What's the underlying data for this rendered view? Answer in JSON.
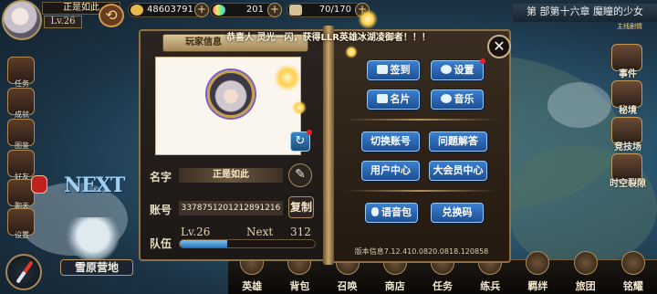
{
  "top": {
    "player_name": "正是如此",
    "level": "Lv.26",
    "resources": [
      {
        "icon": "gold-coin-icon",
        "value": "48603791"
      },
      {
        "icon": "rainbow-crystal-icon",
        "value": "201"
      },
      {
        "icon": "scroll-stamina-icon",
        "value": "70/170"
      }
    ],
    "chapter_title": "第 部第十六章 魔瞳的少女",
    "sub_chapter": "主线剧情"
  },
  "left_menu": [
    {
      "label": "任务",
      "icon": "quest-icon"
    },
    {
      "label": "成就",
      "icon": "achievement-icon"
    },
    {
      "label": "图鉴",
      "icon": "codex-icon"
    },
    {
      "label": "好友",
      "icon": "friend-icon"
    },
    {
      "label": "聊天",
      "icon": "chat-icon"
    },
    {
      "label": "设置",
      "icon": "setting-icon"
    }
  ],
  "next_logo": "NEXT",
  "map_node_label": "雪原营地",
  "right_menu": [
    {
      "label": "事件",
      "icon": "event-icon"
    },
    {
      "label": "秘境",
      "icon": "secret-realm-icon"
    },
    {
      "label": "竞技场",
      "icon": "arena-icon"
    },
    {
      "label": "时空裂隙",
      "icon": "rift-icon"
    }
  ],
  "bottom_nav": [
    "英雄",
    "背包",
    "召唤",
    "商店",
    "任务",
    "练兵",
    "羁绊",
    "旅团",
    "铭耀"
  ],
  "dialog": {
    "announcement": "恭喜人 灵光一闪，获得LLR英雄冰湖凌御者！！！",
    "title": "玩家信息",
    "name_label": "名字",
    "name_value": "正是如此",
    "account_label": "账号",
    "account_value": "3378751201212891216",
    "copy_label": "复制",
    "team_label": "队伍",
    "level_text": "Lv.26",
    "next_label": "Next",
    "next_value": "312",
    "exp_progress": 0.35,
    "buttons": {
      "sign_in": "签到",
      "settings": "设置",
      "card": "名片",
      "music": "音乐",
      "switch_account": "切换账号",
      "faq": "问题解答",
      "user_center": "用户中心",
      "vip_center": "大会员中心",
      "voice_pack": "语音包",
      "redeem_code": "兑换码"
    },
    "version": "版本信息7.12.410.0820.0818.120858"
  }
}
